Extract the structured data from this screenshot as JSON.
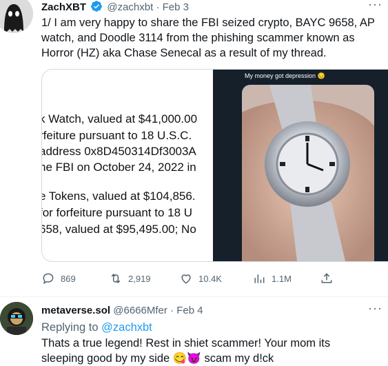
{
  "tweet1": {
    "author_name": "ZachXBT",
    "handle": "@zachxbt",
    "date": "Feb 3",
    "more": "···",
    "text": "1/ I am very happy to share the FBI seized crypto, BAYC 9658, AP watch, and Doodle 3114 from the phishing scammer known as Horror (HZ) aka Chase Senecal as a result of my thread.",
    "media": {
      "document_lines": [
        "k Watch, valued at $41,000.00",
        "rfeiture pursuant to 18 U.S.C.",
        "address 0x8D450314Df3003A",
        "he FBI on October 24, 2022 in",
        "e Tokens, valued at $104,856.",
        "for forfeiture pursuant to 18 U",
        "658, valued at $95,495.00; No"
      ],
      "photo_caption": "My money got depression 😔"
    },
    "actions": {
      "replies": "869",
      "retweets": "2,919",
      "likes": "10.4K",
      "views": "1.1M"
    }
  },
  "tweet2": {
    "author_name": "metaverse.sol",
    "handle": "@6666Mfer",
    "date": "Feb 4",
    "more": "···",
    "replying_prefix": "Replying to",
    "replying_to": "@zachxbt",
    "text_line1": "Thats a true legend! Rest in shiet scammer! Your mom its",
    "text_line2": "sleeping good by my side 😋😈 scam my d!ck"
  },
  "colors": {
    "accent": "#1d9bf0",
    "muted": "#536471",
    "text": "#0f1419",
    "verified": "#1d9bf0"
  }
}
